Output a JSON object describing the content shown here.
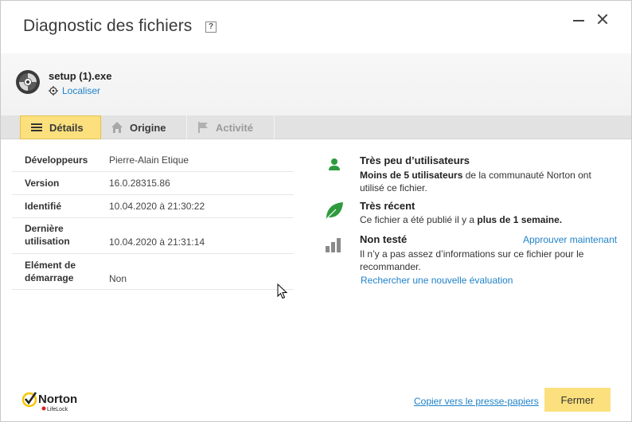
{
  "window": {
    "title": "Diagnostic des fichiers",
    "help_glyph": "?"
  },
  "file": {
    "name": "setup (1).exe",
    "locate_label": "Localiser"
  },
  "tabs": [
    {
      "label": "Détails",
      "active": true,
      "icon": "list-icon"
    },
    {
      "label": "Origine",
      "active": false,
      "icon": "home-icon"
    },
    {
      "label": "Activité",
      "active": false,
      "icon": "flag-icon"
    }
  ],
  "details": [
    {
      "key": "Développeurs",
      "value": "Pierre-Alain Etique"
    },
    {
      "key": "Version",
      "value": "16.0.28315.86"
    },
    {
      "key": "Identifié",
      "value": "10.04.2020 à 21:30:22"
    },
    {
      "key_line1": "Dernière",
      "key_line2": "utilisation",
      "value": "10.04.2020 à 21:31:14"
    },
    {
      "key_line1": "Elément de",
      "key_line2": "démarrage",
      "value": "Non"
    }
  ],
  "insights": {
    "users": {
      "title": "Très peu d’utilisateurs",
      "text_bold": "Moins de 5 utilisateurs",
      "text_rest": " de la communauté Norton ont utilisé ce fichier.",
      "icon": "user-icon"
    },
    "recent": {
      "title": "Très récent",
      "text_start": "Ce fichier a été publié il y a ",
      "text_bold": "plus de 1 semaine.",
      "icon": "leaf-icon"
    },
    "tested": {
      "title": "Non testé",
      "approve_label": "Approuver maintenant",
      "text": "Il n’y a pas assez d’informations sur ce fichier pour le recommander.",
      "search_label": "Rechercher une nouvelle évaluation",
      "icon": "signal-bars-icon"
    }
  },
  "footer": {
    "logo_text": "Norton",
    "logo_subtext": "LifeLock",
    "copy_label": "Copier vers le presse-papiers",
    "close_label": "Fermer"
  },
  "colors": {
    "accent_yellow": "#fbe07d",
    "link_blue": "#1f82c8",
    "green": "#2e9a3e"
  }
}
